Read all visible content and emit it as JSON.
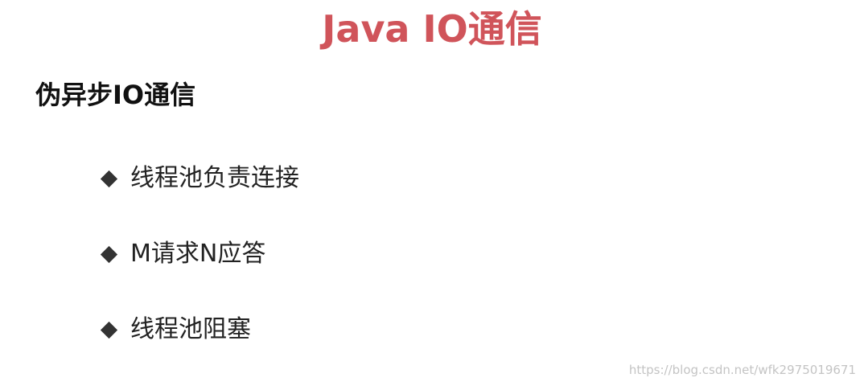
{
  "title": "Java IO通信",
  "heading": "伪异步IO通信",
  "bullets": [
    {
      "text": "线程池负责连接",
      "icon": "diamond-bullet-icon"
    },
    {
      "text": "M请求N应答",
      "icon": "diamond-bullet-icon"
    },
    {
      "text": "线程池阻塞",
      "icon": "diamond-bullet-icon"
    }
  ],
  "watermark": "https://blog.csdn.net/wfk2975019671",
  "colors": {
    "title": "#d0545a",
    "heading": "#111111",
    "bullet": "#333333",
    "watermark": "#c4c4c4"
  }
}
